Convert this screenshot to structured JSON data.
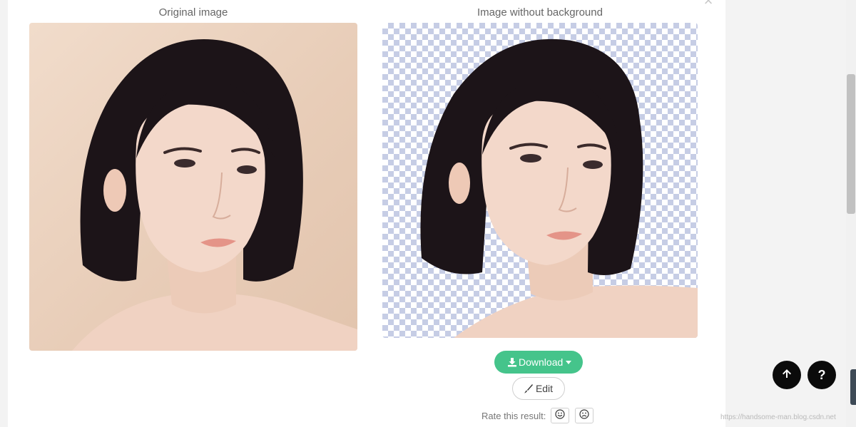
{
  "modal": {
    "close_glyph": "×",
    "original_title": "Original image",
    "result_title": "Image without background"
  },
  "actions": {
    "download_label": "Download",
    "edit_label": "Edit",
    "rate_label": "Rate this result:"
  },
  "icons": {
    "close": "close-icon",
    "download": "download-icon",
    "caret": "chevron-down-icon",
    "edit": "brush-icon",
    "smile": "smile-icon",
    "frown": "frown-icon",
    "scroll_top": "arrow-up-icon",
    "help": "question-icon"
  },
  "help_glyph": "?",
  "watermark": "https://handsome-man.blog.csdn.net",
  "colors": {
    "accent": "#45c48b",
    "fab": "#0b0b0b",
    "checker": "#c6cde5"
  }
}
